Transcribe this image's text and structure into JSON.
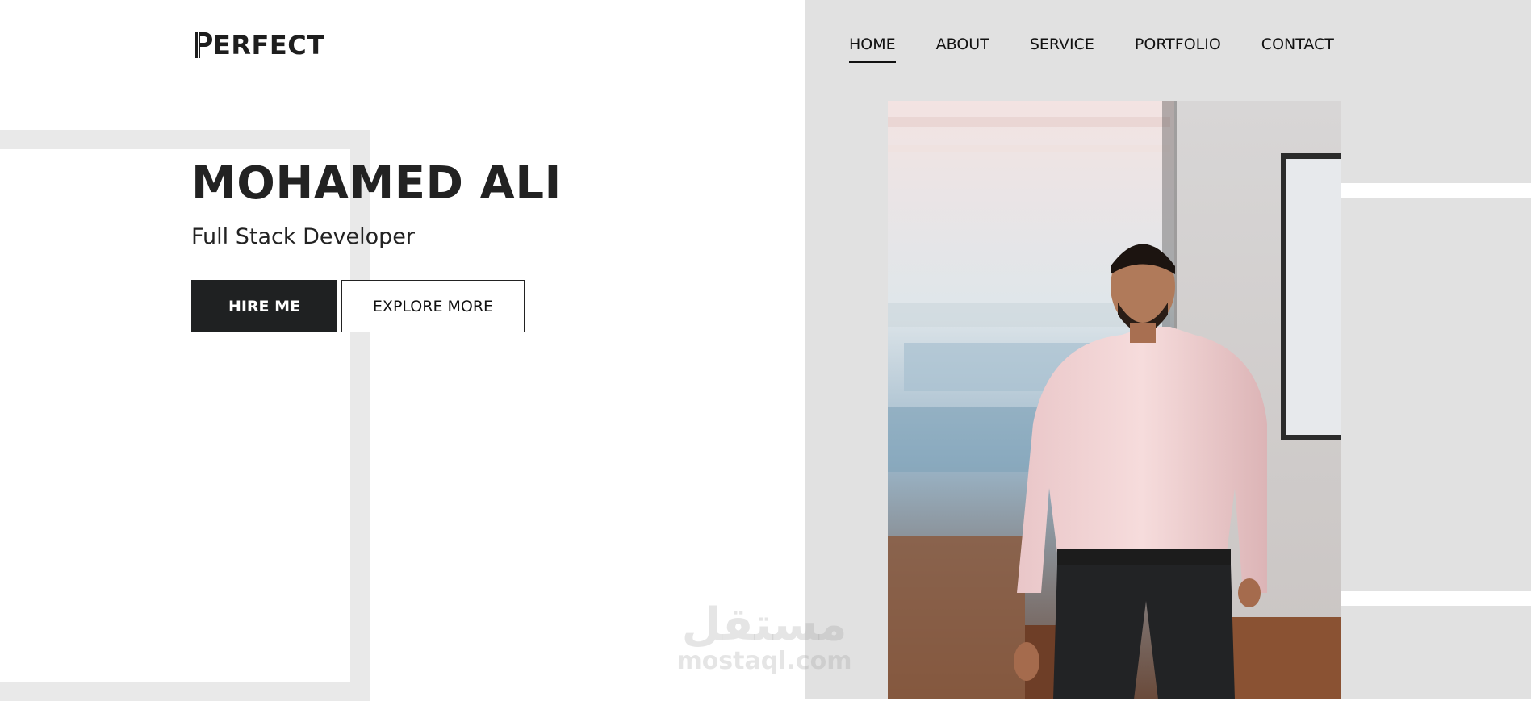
{
  "brand": {
    "logo_text": "ERFECT",
    "logo_mark": "P"
  },
  "nav": {
    "items": [
      {
        "label": "HOME",
        "active": true
      },
      {
        "label": "ABOUT",
        "active": false
      },
      {
        "label": "SERVICE",
        "active": false
      },
      {
        "label": "PORTFOLIO",
        "active": false
      },
      {
        "label": "CONTACT",
        "active": false
      }
    ]
  },
  "hero": {
    "name": "MOHAMED ALI",
    "role": "Full Stack Developer",
    "hire_label": "HIRE ME",
    "explore_label": "EXPLORE MORE"
  },
  "photo": {
    "subject": "portrait-photo"
  },
  "watermark": {
    "arabic": "مستقل",
    "latin": "mostaql.com"
  },
  "colors": {
    "panel": "#e1e1e1",
    "dark": "#1f2122",
    "text": "#222222"
  }
}
